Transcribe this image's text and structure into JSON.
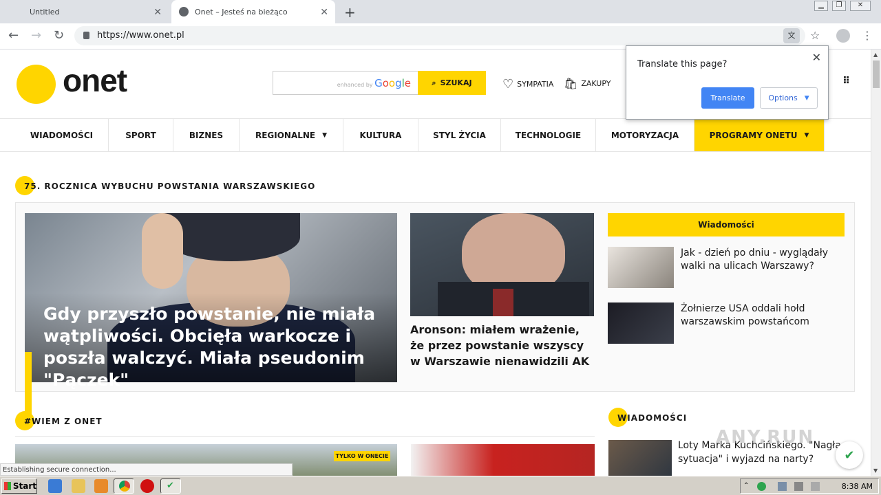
{
  "browser": {
    "tabs": [
      {
        "label": "Untitled",
        "active": false
      },
      {
        "label": "Onet – Jesteś na bieżąco",
        "active": true
      }
    ],
    "url": "https://www.onet.pl",
    "status_text": "Establishing secure connection..."
  },
  "translate_popup": {
    "title": "Translate this page?",
    "translate_label": "Translate",
    "options_label": "Options"
  },
  "header": {
    "logo_text": "onet",
    "search_enhanced": "enhanced by",
    "search_google": "Google",
    "search_button": "SZUKAJ",
    "links": [
      "SYMPATIA",
      "ZAKUPY"
    ]
  },
  "nav": [
    {
      "label": "WIADOMOŚCI"
    },
    {
      "label": "SPORT"
    },
    {
      "label": "BIZNES"
    },
    {
      "label": "REGIONALNE"
    },
    {
      "label": "KULTURA"
    },
    {
      "label": "STYL ŻYCIA"
    },
    {
      "label": "TECHNOLOGIE"
    },
    {
      "label": "MOTORYZACJA"
    },
    {
      "label": "PROGRAMY ONETU"
    }
  ],
  "section1": {
    "title": "75. ROCZNICA WYBUCHU POWSTANIA WARSZAWSKIEGO",
    "main_headline": "Gdy przyszło powstanie, nie miała wątpliwości. Obcięła warkocze i poszła walczyć. Miała pseudonim \"Pączek\"",
    "second_headline": "Aronson: miałem wrażenie, że przez powstanie wszyscy w Warszawie nienawidzili AK",
    "side_header": "Wiadomości",
    "side_items": [
      {
        "text": "Jak - dzień po dniu - wyglądały walki na ulicach Warszawy?"
      },
      {
        "text": "Żołnierze USA oddali hołd warszawskim powstańcom"
      }
    ]
  },
  "section2": {
    "title": "#WIEM Z ONET",
    "badge": "TYLKO W ONECIE"
  },
  "section3": {
    "title": "WIADOMOŚCI",
    "item_text": "Loty Marka Kuchcińskiego. \"Nagła sytuacja\" i wyjazd na narty?"
  },
  "watermark": "ANY.RUN",
  "taskbar": {
    "start_label": "Start",
    "clock": "8:38 AM"
  },
  "colors": {
    "brand_yellow": "#ffd500",
    "chrome_blue": "#4285f4"
  }
}
